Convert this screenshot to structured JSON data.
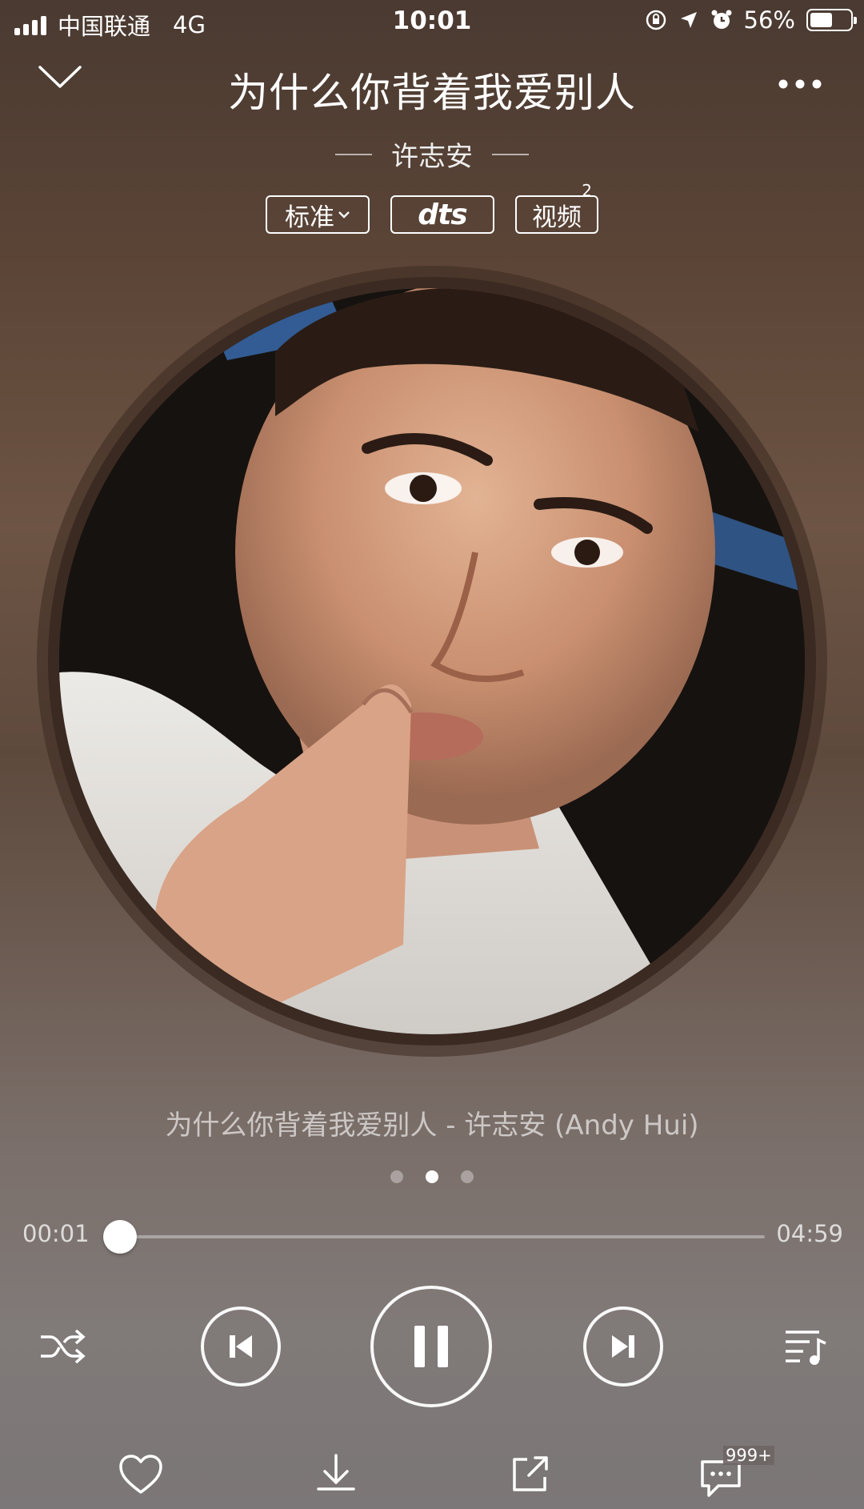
{
  "status_bar": {
    "carrier": "中国联通",
    "network": "4G",
    "time": "10:01",
    "battery_percent": "56%",
    "battery_level": 0.56,
    "icons": [
      "signal-icon",
      "orientation-lock-icon",
      "location-icon",
      "alarm-icon",
      "battery-icon"
    ]
  },
  "header": {
    "title": "为什么你背着我爱别人",
    "artist": "许志安",
    "quality_label": "标准",
    "dts_label": "dts",
    "video_label": "视频",
    "video_count": "2"
  },
  "album_art": {
    "icon": "album-cover-portrait"
  },
  "player": {
    "song_line": "为什么你背着我爱别人 - 许志安 (Andy Hui)",
    "page_count": 3,
    "active_page": 2,
    "current_time": "00:01",
    "total_time": "04:59",
    "progress_fraction": 0.003
  },
  "bottom_actions": {
    "comment_count": "999+"
  },
  "colors": {
    "accent": "#ffffff",
    "background_top": "#4a3a31",
    "background_bottom": "#7b7677"
  }
}
